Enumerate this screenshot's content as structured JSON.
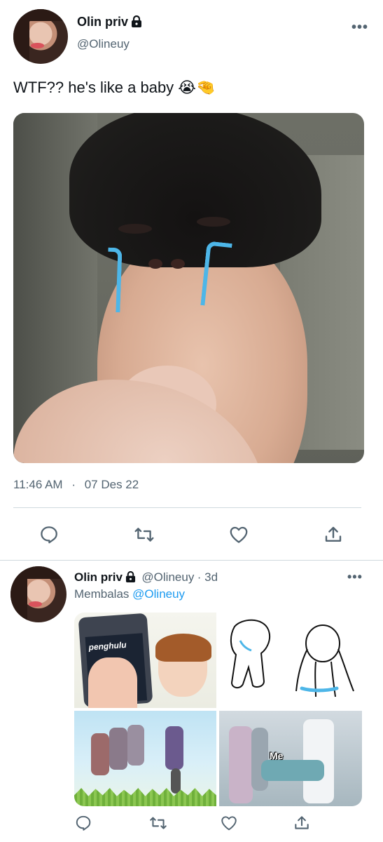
{
  "main_tweet": {
    "author_name": "Olin priv",
    "author_handle": "@Olineuy",
    "more_label": "•••",
    "text": "WTF?? he's like a baby 😭🤏",
    "time": "11:46 AM",
    "separator": "·",
    "date": "07 Des 22"
  },
  "actions": [
    {
      "name": "reply",
      "icon": "reply-icon"
    },
    {
      "name": "retweet",
      "icon": "retweet-icon"
    },
    {
      "name": "like",
      "icon": "heart-icon"
    },
    {
      "name": "share",
      "icon": "share-icon"
    }
  ],
  "reply_tweet": {
    "author_name": "Olin priv",
    "author_handle": "@Olineuy",
    "age": "· 3d",
    "reply_prefix": "Membalas",
    "reply_mention": "@Olineuy",
    "more_label": "•••",
    "meme": {
      "phone_text": "penghulu",
      "hospital_text": "Me"
    }
  },
  "colors": {
    "text": "#0f1419",
    "secondary": "#536471",
    "accent": "#1d9bf0",
    "divider": "#cfd9de"
  }
}
